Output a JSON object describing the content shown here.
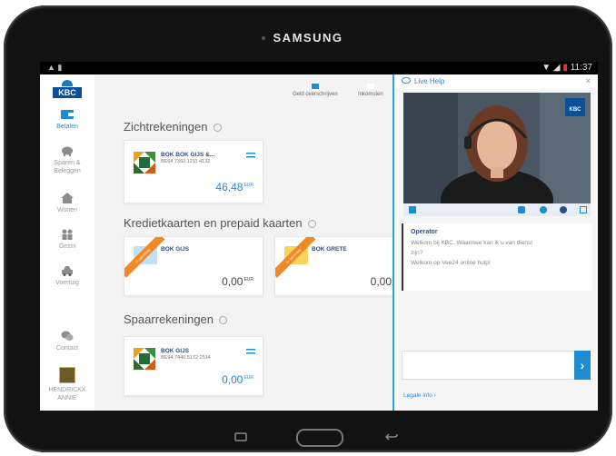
{
  "device": {
    "brand": "SAMSUNG"
  },
  "status_bar": {
    "time": "11:37"
  },
  "sidebar": {
    "logo_text": "KBC",
    "items": [
      {
        "label": "Betalen",
        "icon": "wallet-icon",
        "active": true
      },
      {
        "label": "Sparen & Beleggen",
        "icon": "piggy-bank-icon"
      },
      {
        "label": "Wonen",
        "icon": "house-icon"
      },
      {
        "label": "Gezin",
        "icon": "family-icon"
      },
      {
        "label": "Voertuig",
        "icon": "car-icon"
      },
      {
        "label": "Contact",
        "icon": "chat-icon"
      },
      {
        "label": "HENDRICKX ANNIE",
        "icon": "user-avatar-icon"
      }
    ]
  },
  "toolbar": {
    "transfer_label": "Geld overschrijven",
    "incoming_label": "Inkomsten"
  },
  "sections": [
    {
      "title": "Zichtrekeningen",
      "cards": [
        {
          "name": "BOK BOK GIJS &...",
          "iban": "BE64 7360 1211 4132",
          "amount": "46,48",
          "currency": "EUR"
        }
      ]
    },
    {
      "title": "Kredietkaarten en prepaid kaarten",
      "cards": [
        {
          "name": "BOK GIJS",
          "amount": "0,00",
          "currency": "EUR",
          "ribbon": "in aanvraag"
        },
        {
          "name": "BOK GRETE",
          "amount": "0,00",
          "currency": "",
          "ribbon": "in aanvraag"
        }
      ]
    },
    {
      "title": "Spaarrekeningen",
      "cards": [
        {
          "name": "BOK GIJS",
          "iban": "BE94 7440 5172 2514",
          "amount": "0,00",
          "currency": "EUR"
        }
      ]
    }
  ],
  "livehelp": {
    "title": "Live Help",
    "video_logo": "KBC",
    "operator_label": "Operator",
    "messages": [
      "Welkom bij KBC. Waarmee kan ik u van dienst",
      "zijn?",
      "Welkom op Vee24 online hulp!"
    ],
    "send_glyph": "›",
    "legal_label": "Legale info",
    "legal_arrow": "›",
    "close_glyph": "×"
  },
  "colors": {
    "accent": "#1f8bd1",
    "kbc_navy": "#0a4f97",
    "ribbon": "#f08a24"
  }
}
